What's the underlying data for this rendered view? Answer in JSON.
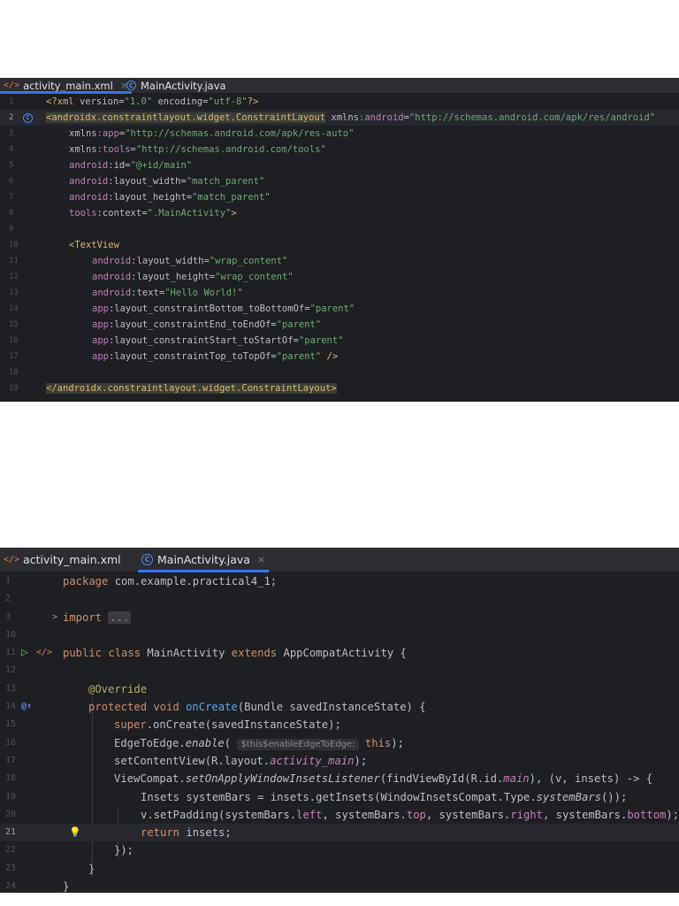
{
  "xml_panel": {
    "tabs": [
      {
        "icon": "xml-icon",
        "icon_text": "</>",
        "label": "activity_main.xml",
        "close": "×",
        "active": true
      },
      {
        "icon": "class-icon",
        "icon_text": "C",
        "label": "MainActivity.java",
        "active": false
      }
    ],
    "line_numbers": [
      "1",
      "2",
      "3",
      "4",
      "5",
      "6",
      "7",
      "8",
      "9",
      "10",
      "11",
      "12",
      "13",
      "14",
      "15",
      "16",
      "17",
      "18",
      "19"
    ],
    "lines": {
      "l1": {
        "a": "<?xml ",
        "b": "version",
        "c": "=",
        "d": "\"1.0\"",
        "e": " encoding",
        "f": "=",
        "g": "\"utf-8\"",
        "h": "?>"
      },
      "l2": {
        "a": "<androidx.constraintlayout.widget.ConstraintLayout",
        "b": " xmlns",
        "c": ":android",
        "d": "=",
        "e": "\"http://schemas.android.com/apk/res/android\""
      },
      "l3": {
        "a": "xmlns",
        "b": ":app",
        "c": "=",
        "d": "\"http://schemas.android.com/apk/res-auto\""
      },
      "l4": {
        "a": "xmlns",
        "b": ":tools",
        "c": "=",
        "d": "\"http://schemas.android.com/tools\""
      },
      "l5": {
        "a": "android",
        "b": ":id",
        "c": "=",
        "d": "\"@+id/main\""
      },
      "l6": {
        "a": "android",
        "b": ":layout_width",
        "c": "=",
        "d": "\"match_parent\""
      },
      "l7": {
        "a": "android",
        "b": ":layout_height",
        "c": "=",
        "d": "\"match_parent\""
      },
      "l8": {
        "a": "tools",
        "b": ":context",
        "c": "=",
        "d": "\".MainActivity\"",
        "e": ">"
      },
      "l10": {
        "a": "<TextView"
      },
      "l11": {
        "a": "android",
        "b": ":layout_width",
        "c": "=",
        "d": "\"wrap_content\""
      },
      "l12": {
        "a": "android",
        "b": ":layout_height",
        "c": "=",
        "d": "\"wrap_content\""
      },
      "l13": {
        "a": "android",
        "b": ":text",
        "c": "=",
        "d": "\"Hello World!\""
      },
      "l14": {
        "a": "app",
        "b": ":layout_constraintBottom_toBottomOf",
        "c": "=",
        "d": "\"parent\""
      },
      "l15": {
        "a": "app",
        "b": ":layout_constraintEnd_toEndOf",
        "c": "=",
        "d": "\"parent\""
      },
      "l16": {
        "a": "app",
        "b": ":layout_constraintStart_toStartOf",
        "c": "=",
        "d": "\"parent\""
      },
      "l17": {
        "a": "app",
        "b": ":layout_constraintTop_toTopOf",
        "c": "=",
        "d": "\"parent\"",
        "e": " />"
      },
      "l19": {
        "a": "</androidx.constraintlayout.widget.ConstraintLayout>"
      }
    },
    "gutter_icon_line2": "C"
  },
  "java_panel": {
    "tabs": [
      {
        "icon": "xml-icon",
        "icon_text": "</>",
        "label": "activity_main.xml",
        "active": false
      },
      {
        "icon": "class-icon",
        "icon_text": "C",
        "label": "MainActivity.java",
        "close": "×",
        "active": true
      }
    ],
    "line_numbers": [
      "1",
      "2",
      "3",
      "10",
      "11",
      "12",
      "13",
      "14",
      "15",
      "16",
      "17",
      "18",
      "19",
      "20",
      "21",
      "22",
      "23",
      "24"
    ],
    "lines": {
      "l1": {
        "a": "package ",
        "b": "com.example.practical4_1;"
      },
      "l3": {
        "fold_arrow": ">",
        "a": "import ",
        "b": "..."
      },
      "l11": {
        "a": "public class ",
        "b": "MainActivity ",
        "c": "extends ",
        "d": "AppCompatActivity {"
      },
      "l13": {
        "a": "@Override"
      },
      "l14": {
        "a": "protected void ",
        "b": "onCreate",
        "c": "(Bundle savedInstanceState) {"
      },
      "l15": {
        "a": "super",
        "b": ".onCreate(savedInstanceState);"
      },
      "l16": {
        "a": "EdgeToEdge.",
        "b": "enable",
        "c": "( ",
        "hint": "$this$enableEdgeToEdge:",
        "d": " this",
        "e": ");"
      },
      "l17": {
        "a": "setContentView(R.layout.",
        "b": "activity_main",
        "c": ");"
      },
      "l18": {
        "a": "ViewCompat.",
        "b": "setOnApplyWindowInsetsListener",
        "c": "(findViewById(R.id.",
        "d": "main",
        "e": "), (v, insets) -> {"
      },
      "l19": {
        "a": "Insets systemBars = insets.getInsets(WindowInsetsCompat.Type.",
        "b": "systemBars",
        "c": "());"
      },
      "l20": {
        "a": "v.setPadding(systemBars.",
        "b": "left",
        "c": ", systemBars.",
        "d": "top",
        "e": ", systemBars.",
        "f": "right",
        "g": ", systemBars.",
        "h": "bottom",
        "i": ");"
      },
      "l21": {
        "a": "return ",
        "b": "insets;"
      },
      "l22": {
        "a": "});"
      },
      "l23": {
        "a": "}"
      },
      "l24": {
        "a": "}"
      }
    },
    "gutter": {
      "run_icon": "▷",
      "xml_icon": "</>",
      "override_icon": "@↑",
      "bulb_icon": "💡"
    }
  }
}
